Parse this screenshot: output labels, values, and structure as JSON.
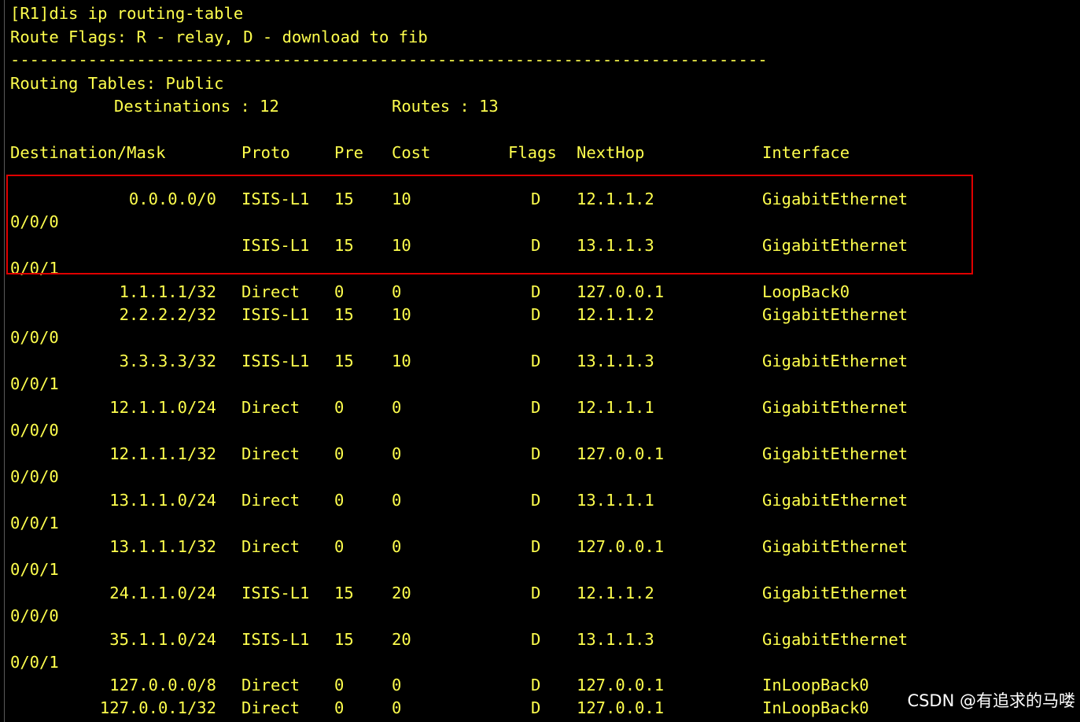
{
  "command": "[R1]dis ip routing-table",
  "flags_legend": "Route Flags: R - relay, D - download to fib",
  "separator": "------------------------------------------------------------------------------",
  "table_title": "Routing Tables: Public",
  "destinations": "Destinations : 12",
  "routes": "Routes : 13",
  "headers": {
    "dest": "Destination/Mask",
    "proto": "Proto",
    "pre": "Pre",
    "cost": "Cost",
    "flags": "Flags",
    "nexthop": "NextHop",
    "iface": "Interface"
  },
  "rows": [
    {
      "dest": "0.0.0.0/0",
      "proto": "ISIS-L1",
      "pre": "15",
      "cost": "10",
      "flags": "D",
      "nexthop": "12.1.1.2",
      "iface": "GigabitEthernet",
      "iface_cont": "0/0/0"
    },
    {
      "dest": "",
      "proto": "ISIS-L1",
      "pre": "15",
      "cost": "10",
      "flags": "D",
      "nexthop": "13.1.1.3",
      "iface": "GigabitEthernet",
      "iface_cont": "0/0/1"
    },
    {
      "dest": "1.1.1.1/32",
      "proto": "Direct",
      "pre": "0",
      "cost": "0",
      "flags": "D",
      "nexthop": "127.0.0.1",
      "iface": "LoopBack0",
      "iface_cont": ""
    },
    {
      "dest": "2.2.2.2/32",
      "proto": "ISIS-L1",
      "pre": "15",
      "cost": "10",
      "flags": "D",
      "nexthop": "12.1.1.2",
      "iface": "GigabitEthernet",
      "iface_cont": "0/0/0"
    },
    {
      "dest": "3.3.3.3/32",
      "proto": "ISIS-L1",
      "pre": "15",
      "cost": "10",
      "flags": "D",
      "nexthop": "13.1.1.3",
      "iface": "GigabitEthernet",
      "iface_cont": "0/0/1"
    },
    {
      "dest": "12.1.1.0/24",
      "proto": "Direct",
      "pre": "0",
      "cost": "0",
      "flags": "D",
      "nexthop": "12.1.1.1",
      "iface": "GigabitEthernet",
      "iface_cont": "0/0/0"
    },
    {
      "dest": "12.1.1.1/32",
      "proto": "Direct",
      "pre": "0",
      "cost": "0",
      "flags": "D",
      "nexthop": "127.0.0.1",
      "iface": "GigabitEthernet",
      "iface_cont": "0/0/0"
    },
    {
      "dest": "13.1.1.0/24",
      "proto": "Direct",
      "pre": "0",
      "cost": "0",
      "flags": "D",
      "nexthop": "13.1.1.1",
      "iface": "GigabitEthernet",
      "iface_cont": "0/0/1"
    },
    {
      "dest": "13.1.1.1/32",
      "proto": "Direct",
      "pre": "0",
      "cost": "0",
      "flags": "D",
      "nexthop": "127.0.0.1",
      "iface": "GigabitEthernet",
      "iface_cont": "0/0/1"
    },
    {
      "dest": "24.1.1.0/24",
      "proto": "ISIS-L1",
      "pre": "15",
      "cost": "20",
      "flags": "D",
      "nexthop": "12.1.1.2",
      "iface": "GigabitEthernet",
      "iface_cont": "0/0/0"
    },
    {
      "dest": "35.1.1.0/24",
      "proto": "ISIS-L1",
      "pre": "15",
      "cost": "20",
      "flags": "D",
      "nexthop": "13.1.1.3",
      "iface": "GigabitEthernet",
      "iface_cont": "0/0/1"
    },
    {
      "dest": "127.0.0.0/8",
      "proto": "Direct",
      "pre": "0",
      "cost": "0",
      "flags": "D",
      "nexthop": "127.0.0.1",
      "iface": "InLoopBack0",
      "iface_cont": ""
    },
    {
      "dest": "127.0.0.1/32",
      "proto": "Direct",
      "pre": "0",
      "cost": "0",
      "flags": "D",
      "nexthop": "127.0.0.1",
      "iface": "InLoopBack0",
      "iface_cont": ""
    }
  ],
  "watermark": "CSDN @有追求的马喽",
  "colors": {
    "background": "#000000",
    "text": "#ffff4d",
    "highlight_box": "#e00000"
  }
}
